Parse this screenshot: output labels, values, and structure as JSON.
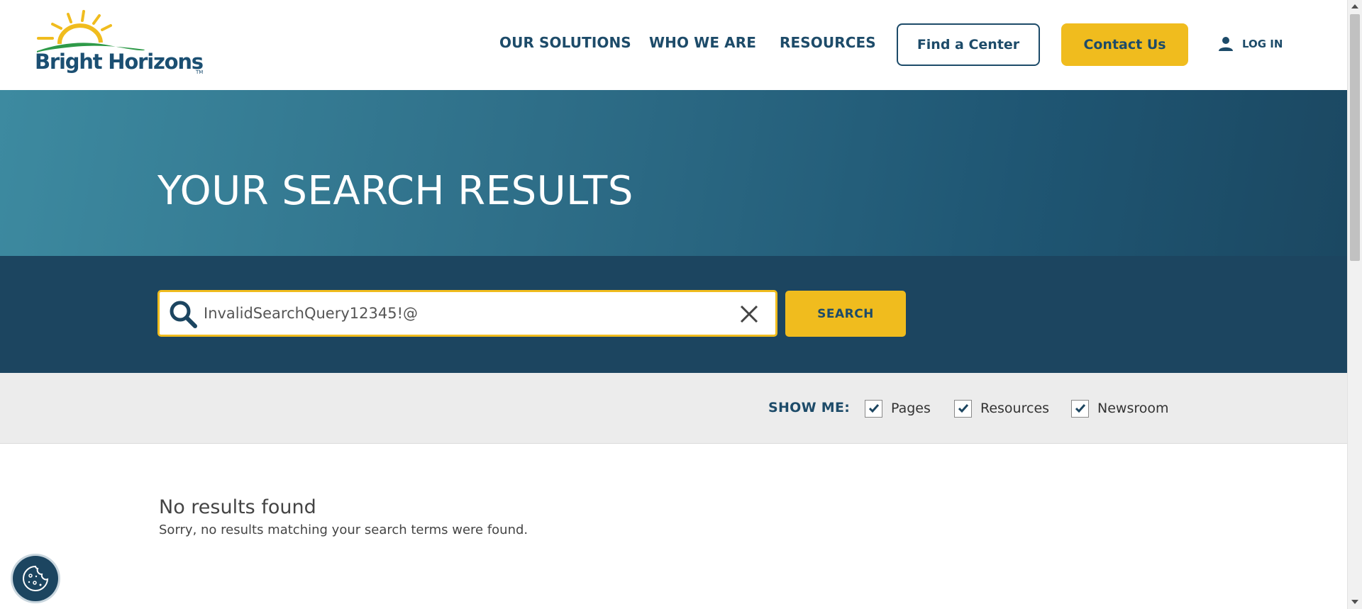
{
  "header": {
    "logo_text": "Bright Horizons",
    "logo_tm": "TM",
    "nav": [
      {
        "label": "OUR SOLUTIONS"
      },
      {
        "label": "WHO WE ARE"
      },
      {
        "label": "RESOURCES"
      }
    ],
    "find_center_label": "Find a Center",
    "contact_label": "Contact Us",
    "login_label": "LOG IN",
    "login_icon": "user-icon"
  },
  "hero": {
    "title": "YOUR SEARCH RESULTS"
  },
  "search": {
    "value": "InvalidSearchQuery12345!@",
    "search_icon": "search-icon",
    "clear_icon": "close-icon",
    "button_label": "SEARCH"
  },
  "filters": {
    "label": "SHOW ME:",
    "options": [
      {
        "label": "Pages",
        "checked": true
      },
      {
        "label": "Resources",
        "checked": true
      },
      {
        "label": "Newsroom",
        "checked": true
      }
    ]
  },
  "results": {
    "title": "No results found",
    "message": "Sorry, no results matching your search terms were found."
  },
  "cookie": {
    "icon": "cookie-icon"
  },
  "colors": {
    "brand_navy": "#1d4b69",
    "brand_yellow": "#f0bc1e",
    "logo_green": "#2e9a48",
    "hero_teal": "#3d8aa0",
    "search_band": "#1c4560",
    "filter_bg": "#ececec"
  }
}
